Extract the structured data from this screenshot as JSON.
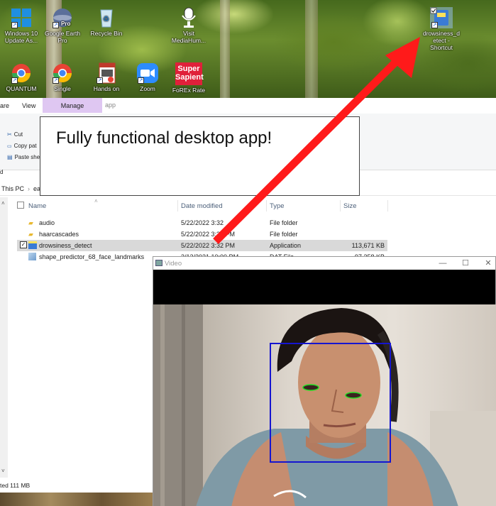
{
  "desktop": {
    "icons": [
      {
        "name": "windows10-update-icon",
        "label": "Windows 10 Update As...",
        "color": "#1f8fe0"
      },
      {
        "name": "google-earth-icon",
        "label": "Google Earth Pro",
        "color": "#5b6f9a"
      },
      {
        "name": "recycle-bin-icon",
        "label": "Recycle Bin",
        "color": "#cfe6f2"
      },
      {
        "name": "mediahuman-icon",
        "label": "Visit MediaHum...",
        "color": "#ffffff"
      },
      {
        "name": "chrome-quantum-icon",
        "label": "QUANTUM",
        "color": "#e94235"
      },
      {
        "name": "chrome-single-icon",
        "label": "Single",
        "color": "#e94235"
      },
      {
        "name": "hands-on-book-icon",
        "label": "Hands on",
        "color": "#c0392b"
      },
      {
        "name": "zoom-icon",
        "label": "Zoom",
        "color": "#2d8cff"
      },
      {
        "name": "super-sapient-icon",
        "label": "FoREx Rate",
        "color": "#e0203a",
        "text": "Super Sapient"
      },
      {
        "name": "drowsiness-shortcut-icon",
        "label": "drowsiness_d etect - Shortcut",
        "color": "#3a7bd5"
      }
    ]
  },
  "explorer": {
    "tabs": {
      "share": "are",
      "view": "View",
      "manage": "Manage",
      "app": "app"
    },
    "ribbon": {
      "cut": "Cut",
      "copy_path": "Copy pat",
      "paste_shortcut": "Paste she",
      "side_label": "d"
    },
    "address": {
      "this_pc": "This PC",
      "crumb": "ea"
    },
    "columns": {
      "name": "Name",
      "date": "Date modified",
      "type": "Type",
      "size": "Size"
    },
    "files": [
      {
        "name": "audio",
        "date": "5/22/2022 3:32",
        "type": "File folder",
        "size": ""
      },
      {
        "name": "haarcascades",
        "date": "5/22/2022 3:32 PM",
        "type": "File folder",
        "size": ""
      },
      {
        "name": "drowsiness_detect",
        "date": "5/22/2022 3:32 PM",
        "type": "Application",
        "size": "113,671 KB"
      },
      {
        "name": "shape_predictor_68_face_landmarks",
        "date": "3/12/2021 10:00 PM",
        "type": "DAT File",
        "size": "97,358 KB"
      }
    ],
    "status": "ted  111 MB"
  },
  "callout": {
    "text": "Fully functional desktop app!"
  },
  "video": {
    "title": "Video",
    "minimize": "—",
    "maximize": "☐",
    "close": "✕"
  },
  "colors": {
    "arrow": "#ff1a1a",
    "face_box": "#1515d0",
    "eye_contour": "#22dd22",
    "manage_tab": "#dfc7f2"
  }
}
